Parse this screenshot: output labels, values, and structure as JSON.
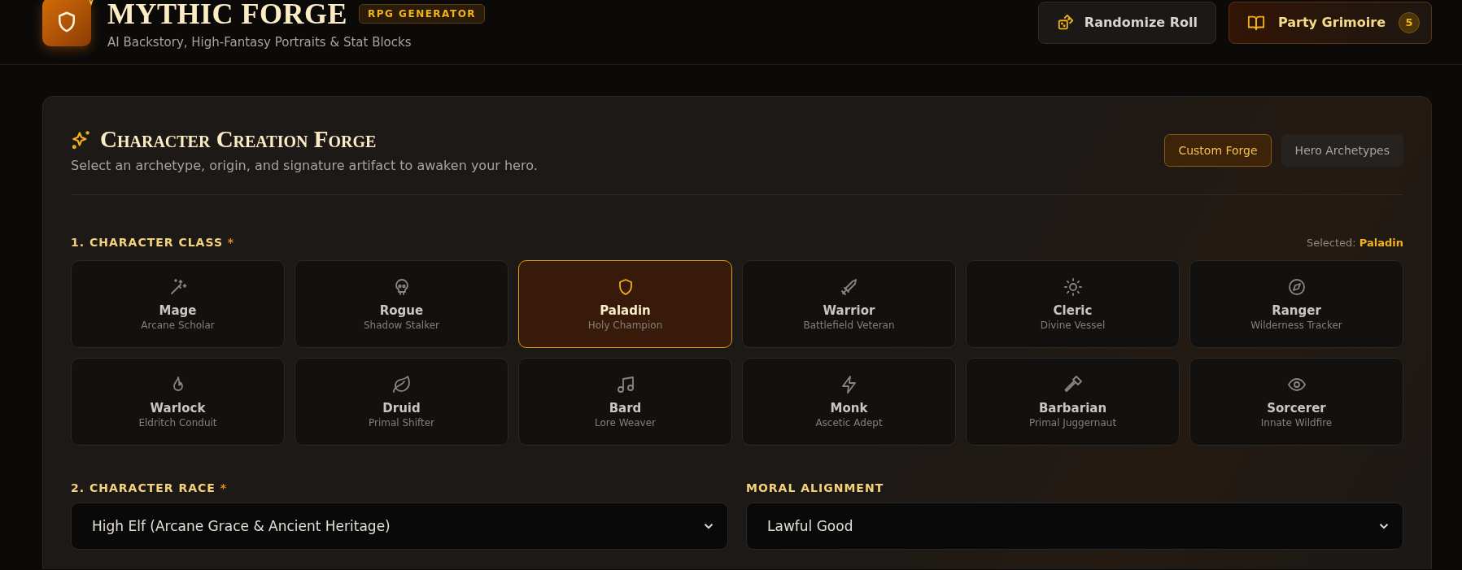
{
  "header": {
    "title": "MYTHIC FORGE",
    "badge": "RPG GENERATOR",
    "subtitle": "AI Backstory, High-Fantasy Portraits & Stat Blocks",
    "actions": [
      {
        "kind": "roll",
        "label": "Randomize Roll"
      },
      {
        "kind": "grimoire",
        "label": "Party Grimoire",
        "count": "5"
      }
    ]
  },
  "forge": {
    "title": "Character Creation Forge",
    "subtitle": "Select an archetype, origin, and signature artifact to awaken your hero.",
    "tabs": [
      {
        "label": "Custom Forge",
        "selected": true
      },
      {
        "label": "Hero Archetypes",
        "selected": false
      }
    ],
    "class_section": {
      "label": "1. CHARACTER CLASS",
      "required_mark": "*",
      "selected_prefix": "Selected:",
      "selected_value": "Paladin",
      "classes": [
        {
          "name": "Mage",
          "subtitle": "Arcane Scholar",
          "selected": false
        },
        {
          "name": "Rogue",
          "subtitle": "Shadow Stalker",
          "selected": false
        },
        {
          "name": "Paladin",
          "subtitle": "Holy Champion",
          "selected": true
        },
        {
          "name": "Warrior",
          "subtitle": "Battlefield Veteran",
          "selected": false
        },
        {
          "name": "Cleric",
          "subtitle": "Divine Vessel",
          "selected": false
        },
        {
          "name": "Ranger",
          "subtitle": "Wilderness Tracker",
          "selected": false
        },
        {
          "name": "Warlock",
          "subtitle": "Eldritch Conduit",
          "selected": false
        },
        {
          "name": "Druid",
          "subtitle": "Primal Shifter",
          "selected": false
        },
        {
          "name": "Bard",
          "subtitle": "Lore Weaver",
          "selected": false
        },
        {
          "name": "Monk",
          "subtitle": "Ascetic Adept",
          "selected": false
        },
        {
          "name": "Barbarian",
          "subtitle": "Primal Juggernaut",
          "selected": false
        },
        {
          "name": "Sorcerer",
          "subtitle": "Innate Wildfire",
          "selected": false
        }
      ]
    },
    "fields": [
      {
        "label": "2. CHARACTER RACE",
        "required_mark": "*",
        "value": "High Elf (Arcane Grace & Ancient Heritage)"
      },
      {
        "label": "MORAL ALIGNMENT",
        "value": "Lawful Good"
      }
    ]
  }
}
